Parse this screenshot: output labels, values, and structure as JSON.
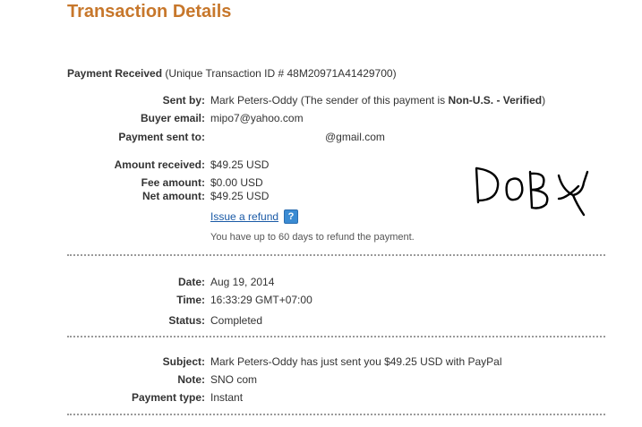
{
  "page": {
    "title": "Transaction Details"
  },
  "payment": {
    "status_heading": "Payment Received",
    "transaction_id_text": "(Unique Transaction ID # 48M20971A41429700)"
  },
  "sender": {
    "label": "Sent by:",
    "name": "Mark Peters-Oddy",
    "note_prefix": "(The sender of this payment is ",
    "note_status": "Non-U.S. - Verified",
    "note_suffix": ")"
  },
  "buyer_email": {
    "label": "Buyer email:",
    "value": "mipo7@yahoo.com"
  },
  "sent_to": {
    "label": "Payment sent to:",
    "value": "@gmail.com"
  },
  "amounts": {
    "received_label": "Amount received:",
    "received_value": "$49.25 USD",
    "fee_label": "Fee amount:",
    "fee_value": "$0.00 USD",
    "net_label": "Net amount:",
    "net_value": "$49.25 USD"
  },
  "refund": {
    "link_label": "Issue a refund",
    "help_icon": "?",
    "note": "You have up to 60 days to refund the payment."
  },
  "timing": {
    "date_label": "Date:",
    "date_value": "Aug 19, 2014",
    "time_label": "Time:",
    "time_value": "16:33:29 GMT+07:00",
    "status_label": "Status:",
    "status_value": "Completed"
  },
  "message": {
    "subject_label": "Subject:",
    "subject_value": "Mark Peters-Oddy has just sent you $49.25 USD with PayPal",
    "note_label": "Note:",
    "note_value": "SNO com",
    "type_label": "Payment type:",
    "type_value": "Instant"
  },
  "annotation": {
    "handwritten_text": "DOBY"
  },
  "colors": {
    "title": "#c7772b",
    "link": "#1a5aa6",
    "help_icon": "#3a8bd3",
    "divider": "#9a9a9a"
  }
}
